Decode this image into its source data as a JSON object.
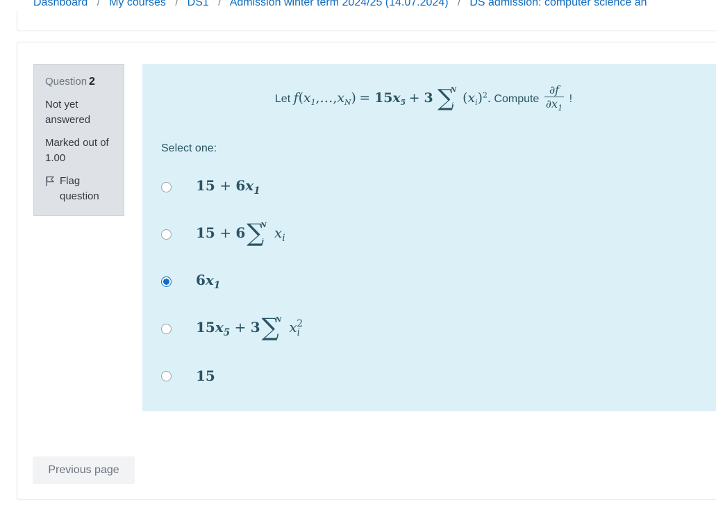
{
  "breadcrumb": {
    "items": [
      {
        "label": "Dashboard",
        "link": true
      },
      {
        "label": "My courses",
        "link": true
      },
      {
        "label": "DS1",
        "link": true
      },
      {
        "label": "Admission winter term 2024/25 (14.07.2024)",
        "link": true
      },
      {
        "label": "DS admission: computer science an",
        "link": true
      }
    ],
    "separator": "/"
  },
  "question_info": {
    "number_label": "Question",
    "number_value": "2",
    "status": "Not yet answered",
    "marks": "Marked out of 1.00",
    "flag_label": "Flag question",
    "flag_icon": "flag-icon"
  },
  "question": {
    "stem_prefix": "Let",
    "stem_text": "Let f(x1,…,xN) = 15x5 + 3 ∑ᵢᴺ (xᵢ)². Compute ∂f/∂x1 !",
    "function_name": "f",
    "var_first": "x",
    "var_first_sub": "1",
    "ellipsis": ",…,",
    "var_last_sub": "N",
    "equals": "=",
    "coef_linear": "15",
    "linear_sub": "5",
    "plus": "+",
    "coef_sum": "3",
    "sum_upper": "N",
    "sum_lower": "i",
    "sum_body_sub": "i",
    "sum_power": "2",
    "period": ".",
    "compute_label": "Compute",
    "deriv_num": "∂f",
    "deriv_den": "∂x",
    "deriv_den_sub": "1",
    "exclaim": "!",
    "select_one_label": "Select one:"
  },
  "answers": [
    {
      "id": "a",
      "text": "15 + 6x1",
      "selected": false
    },
    {
      "id": "b",
      "text": "15 + 6 ∑ᵢᴺ xᵢ",
      "selected": false
    },
    {
      "id": "c",
      "text": "6x1",
      "selected": true
    },
    {
      "id": "d",
      "text": "15x5 + 3 ∑ᵢᴺ xᵢ²",
      "selected": false
    },
    {
      "id": "e",
      "text": "15",
      "selected": false
    }
  ],
  "navigation": {
    "previous_page_label": "Previous page"
  },
  "colors": {
    "link": "#0f6cbf",
    "question_bg": "#dcf0f8",
    "info_bg": "#dee2e6",
    "math_text": "#2a5463",
    "radio_selected": "#0f6fc5",
    "button_bg": "#f2f3f5"
  }
}
